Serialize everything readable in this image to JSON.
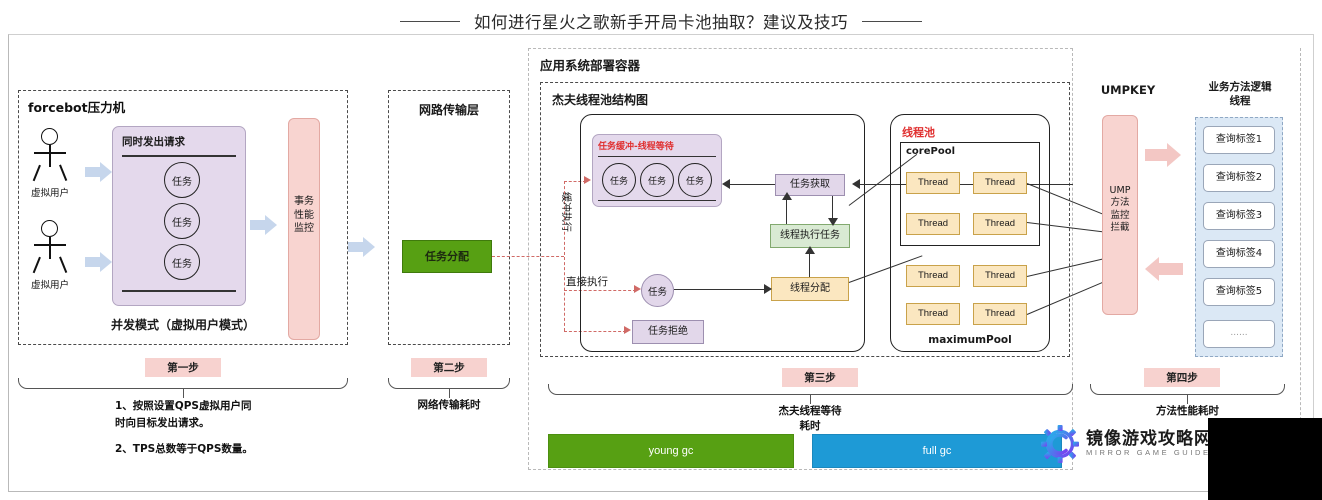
{
  "page": {
    "title": "如何进行星火之歌新手开局卡池抽取？建议及技巧"
  },
  "section1": {
    "title": "forcebot压力机",
    "users": [
      {
        "label": "虚拟用户"
      },
      {
        "label": "虚拟用户"
      }
    ],
    "request_box_title": "同时发出请求",
    "tasks": [
      "任务",
      "任务",
      "任务"
    ],
    "mode_label": "并发模式（虚拟用户模式）",
    "monitor_label": "事务\n性能\n监控",
    "monitor_line1": "事务",
    "monitor_line2": "性能",
    "monitor_line3": "监控",
    "step_tag": "第一步",
    "notes_1": "1、按照设置QPS虚拟用户同",
    "notes_2": "时向目标发出请求。",
    "notes_3": "2、TPS总数等于QPS数量。"
  },
  "section2": {
    "title": "网路传输层",
    "dispatch_label": "任务分配",
    "step_tag": "第二步",
    "caption": "网络传输耗时"
  },
  "section3": {
    "container_title": "应用系统部署容器",
    "pool_diagram_title": "杰夫线程池结构图",
    "buffer_title": "任务缓冲-线程等待",
    "buffer_tasks": [
      "任务",
      "任务",
      "任务"
    ],
    "rot_label": "缓冲执行",
    "direct_label": "直接执行",
    "task_circle": "任务",
    "reject_label": "任务拒绝",
    "fetch_label": "任务获取",
    "exec_label": "线程执行任务",
    "alloc_label": "线程分配",
    "thread_pool_title": "线程池",
    "core_pool_label": "corePool",
    "maximum_pool_label": "maximumPool",
    "thread_label": "Thread",
    "threads_core": [
      "Thread",
      "Thread",
      "Thread",
      "Thread"
    ],
    "threads_max": [
      "Thread",
      "Thread",
      "Thread",
      "Thread"
    ],
    "step_tag": "第三步",
    "caption_1": "杰夫线程等待",
    "caption_2": "耗时",
    "gc_young": "young gc",
    "gc_full": "full gc"
  },
  "section4": {
    "umpkey_title": "UMPKEY",
    "ump_line1": "UMP",
    "ump_line2": "方法",
    "ump_line3": "监控",
    "ump_line4": "拦截",
    "step_tag": "第四步",
    "caption": "方法性能耗时"
  },
  "section5": {
    "title_line1": "业务方法逻辑",
    "title_line2": "线程",
    "tags": [
      "查询标签1",
      "查询标签2",
      "查询标签3",
      "查询标签4",
      "查询标签5",
      "......"
    ]
  },
  "watermark": {
    "cn": "镜像游戏攻略网",
    "en": "MIRROR GAME GUIDE"
  },
  "colors": {
    "accent_pink": "#f7d2cf",
    "purple": "#e2d7ea",
    "green": "#d9ead3",
    "yellow": "#fbe7c0",
    "blue_arrow": "#c6d6ec",
    "gc_young": "#57a013",
    "gc_full": "#1e9ad6",
    "red_text": "#e03030"
  }
}
